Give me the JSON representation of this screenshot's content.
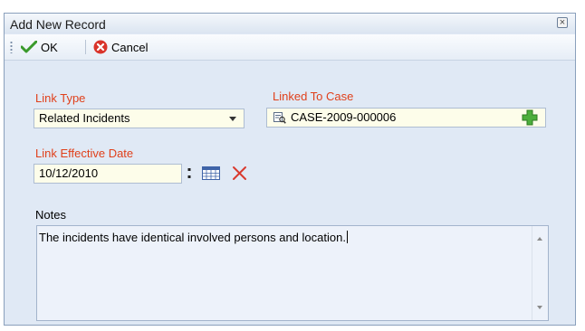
{
  "window": {
    "title": "Add New Record",
    "close_glyph": "×"
  },
  "toolbar": {
    "ok_label": "OK",
    "cancel_label": "Cancel",
    "icons": {
      "ok": "checkmark-icon",
      "cancel": "cancel-circle-icon"
    }
  },
  "form": {
    "link_type": {
      "label": "Link Type",
      "value": "Related Incidents"
    },
    "linked_to_case": {
      "label": "Linked To Case",
      "value": "CASE-2009-000006"
    },
    "link_effective_date": {
      "label": "Link Effective Date",
      "value": "10/12/2010"
    },
    "notes": {
      "label": "Notes",
      "value": "The incidents have identical involved persons and location."
    }
  },
  "colors": {
    "required_label": "#e0401b",
    "field_background": "#fdfdea",
    "form_background": "#e0e9f5"
  }
}
